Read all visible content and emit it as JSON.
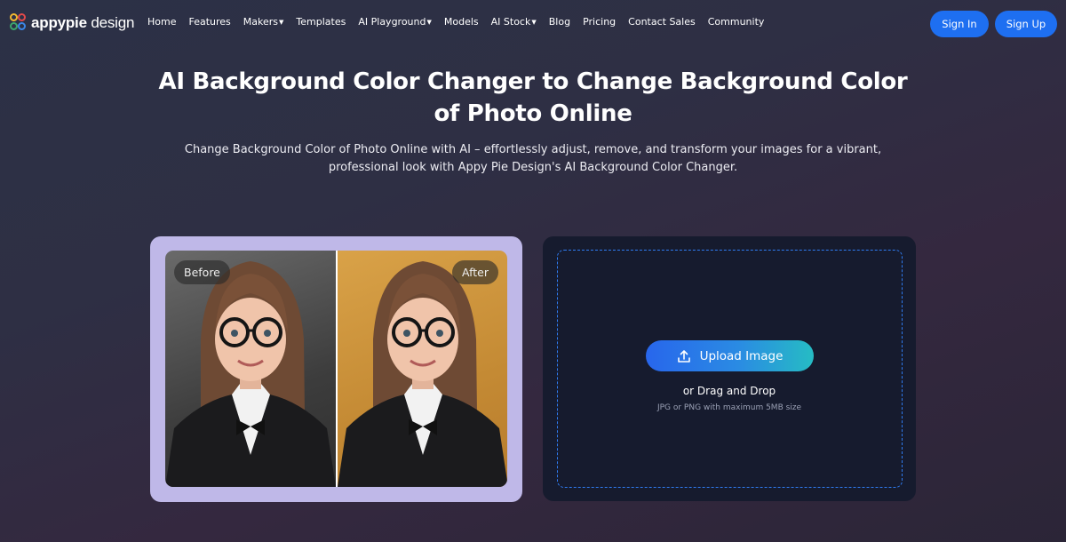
{
  "brand": {
    "name_bold": "appypie",
    "name_light": " design"
  },
  "nav": {
    "items": [
      {
        "label": "Home",
        "dropdown": false
      },
      {
        "label": "Features",
        "dropdown": false
      },
      {
        "label": "Makers",
        "dropdown": true
      },
      {
        "label": "Templates",
        "dropdown": false
      },
      {
        "label": "AI Playground",
        "dropdown": true
      },
      {
        "label": "Models",
        "dropdown": false
      },
      {
        "label": "AI Stock",
        "dropdown": true
      },
      {
        "label": "Blog",
        "dropdown": false
      },
      {
        "label": "Pricing",
        "dropdown": false
      },
      {
        "label": "Contact Sales",
        "dropdown": false
      },
      {
        "label": "Community",
        "dropdown": false
      }
    ],
    "sign_in": "Sign In",
    "sign_up": "Sign Up"
  },
  "hero": {
    "title_line1": "AI Background Color Changer to Change Background Color",
    "title_line2": "of Photo Online",
    "subtitle_line1": "Change Background Color of Photo Online with AI – effortlessly adjust, remove, and transform your images for a vibrant,",
    "subtitle_line2": "professional look with Appy Pie Design's AI Background Color Changer."
  },
  "compare": {
    "before_label": "Before",
    "after_label": "After"
  },
  "upload": {
    "button_label": "Upload Image",
    "drag_text": "or Drag and Drop",
    "hint": "JPG or PNG with maximum 5MB size"
  },
  "colors": {
    "accent": "#1e6ff1",
    "before_bg": "#555555",
    "after_bg": "#c98f38",
    "card_frame": "#bfb8e8"
  }
}
